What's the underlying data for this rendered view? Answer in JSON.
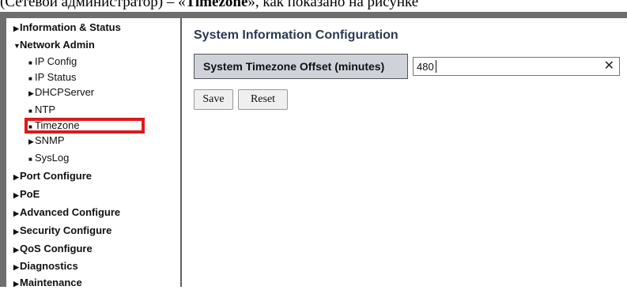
{
  "top_caption": {
    "prefix": "(Сетевой администратор) – «",
    "bold": "Timezone",
    "suffix": "», как показано на рисунке"
  },
  "sidebar": {
    "items": [
      {
        "label": "Information & Status",
        "level": "top",
        "marker": "collapsed"
      },
      {
        "label": "Network Admin",
        "level": "top",
        "marker": "expanded"
      },
      {
        "label": "IP Config",
        "level": "sub",
        "marker": "bullet"
      },
      {
        "label": "IP Status",
        "level": "sub",
        "marker": "bullet"
      },
      {
        "label": "DHCPServer",
        "level": "sub",
        "marker": "collapsed"
      },
      {
        "label": "NTP",
        "level": "sub",
        "marker": "bullet"
      },
      {
        "label": "Timezone",
        "level": "sub",
        "marker": "bullet",
        "highlighted": true
      },
      {
        "label": "SNMP",
        "level": "sub",
        "marker": "collapsed"
      },
      {
        "label": "SysLog",
        "level": "sub",
        "marker": "bullet"
      },
      {
        "label": "Port Configure",
        "level": "top",
        "marker": "collapsed"
      },
      {
        "label": "PoE",
        "level": "top",
        "marker": "collapsed"
      },
      {
        "label": "Advanced Configure",
        "level": "top",
        "marker": "collapsed"
      },
      {
        "label": "Security Configure",
        "level": "top",
        "marker": "collapsed"
      },
      {
        "label": "QoS Configure",
        "level": "top",
        "marker": "collapsed"
      },
      {
        "label": "Diagnostics",
        "level": "top",
        "marker": "collapsed"
      },
      {
        "label": "Maintenance",
        "level": "top",
        "marker": "collapsed"
      }
    ]
  },
  "main": {
    "title": "System Information Configuration",
    "timezone": {
      "label": "System Timezone Offset (minutes)",
      "value": "480"
    },
    "buttons": {
      "save": "Save",
      "reset": "Reset"
    }
  },
  "icons": {
    "collapsed": "triangle-right-icon",
    "expanded": "triangle-down-icon",
    "bullet": "square-bullet-icon",
    "clear": "close-icon"
  },
  "colors": {
    "title": "#2a3a55",
    "label_bg": "#cfd3d9",
    "highlight": "#e01818",
    "frame": "#6e6e6e"
  }
}
